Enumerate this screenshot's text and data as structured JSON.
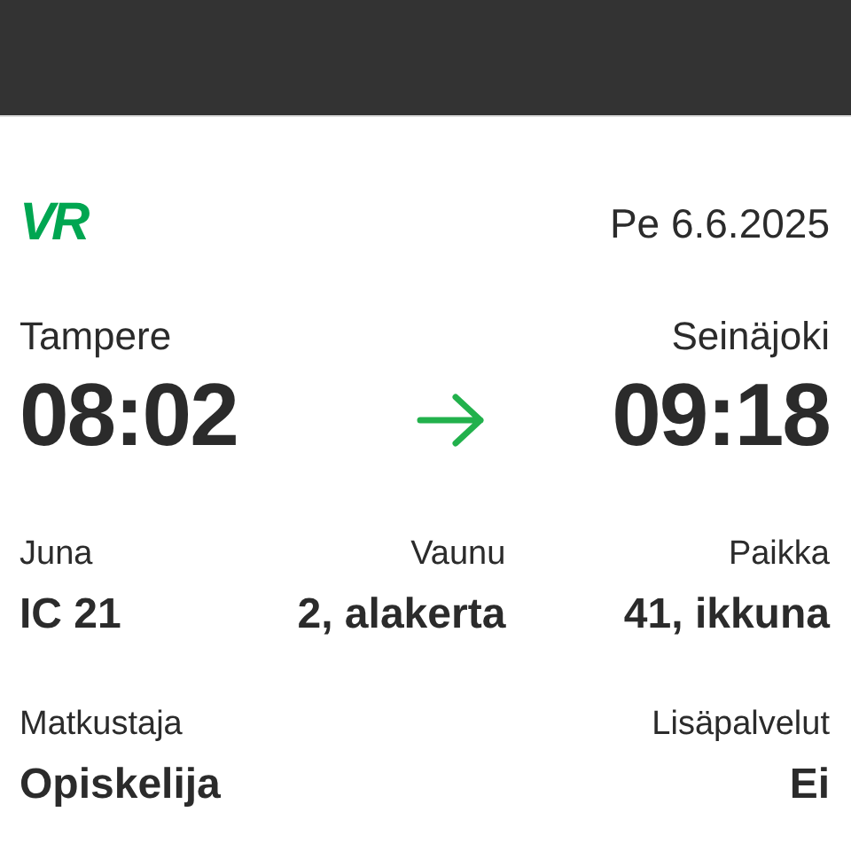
{
  "logo": {
    "text": "VR"
  },
  "date": "Pe 6.6.2025",
  "journey": {
    "from": {
      "station": "Tampere",
      "time": "08:02"
    },
    "to": {
      "station": "Seinäjoki",
      "time": "09:18"
    }
  },
  "details": [
    {
      "label": "Juna",
      "value": "IC 21"
    },
    {
      "label": "Vaunu",
      "value": "2, alakerta"
    },
    {
      "label": "Paikka",
      "value": "41, ikkuna"
    },
    {
      "label": "Matkustaja",
      "value": "Opiskelija"
    },
    {
      "label": "Lisäpalvelut",
      "value": "Ei"
    }
  ]
}
